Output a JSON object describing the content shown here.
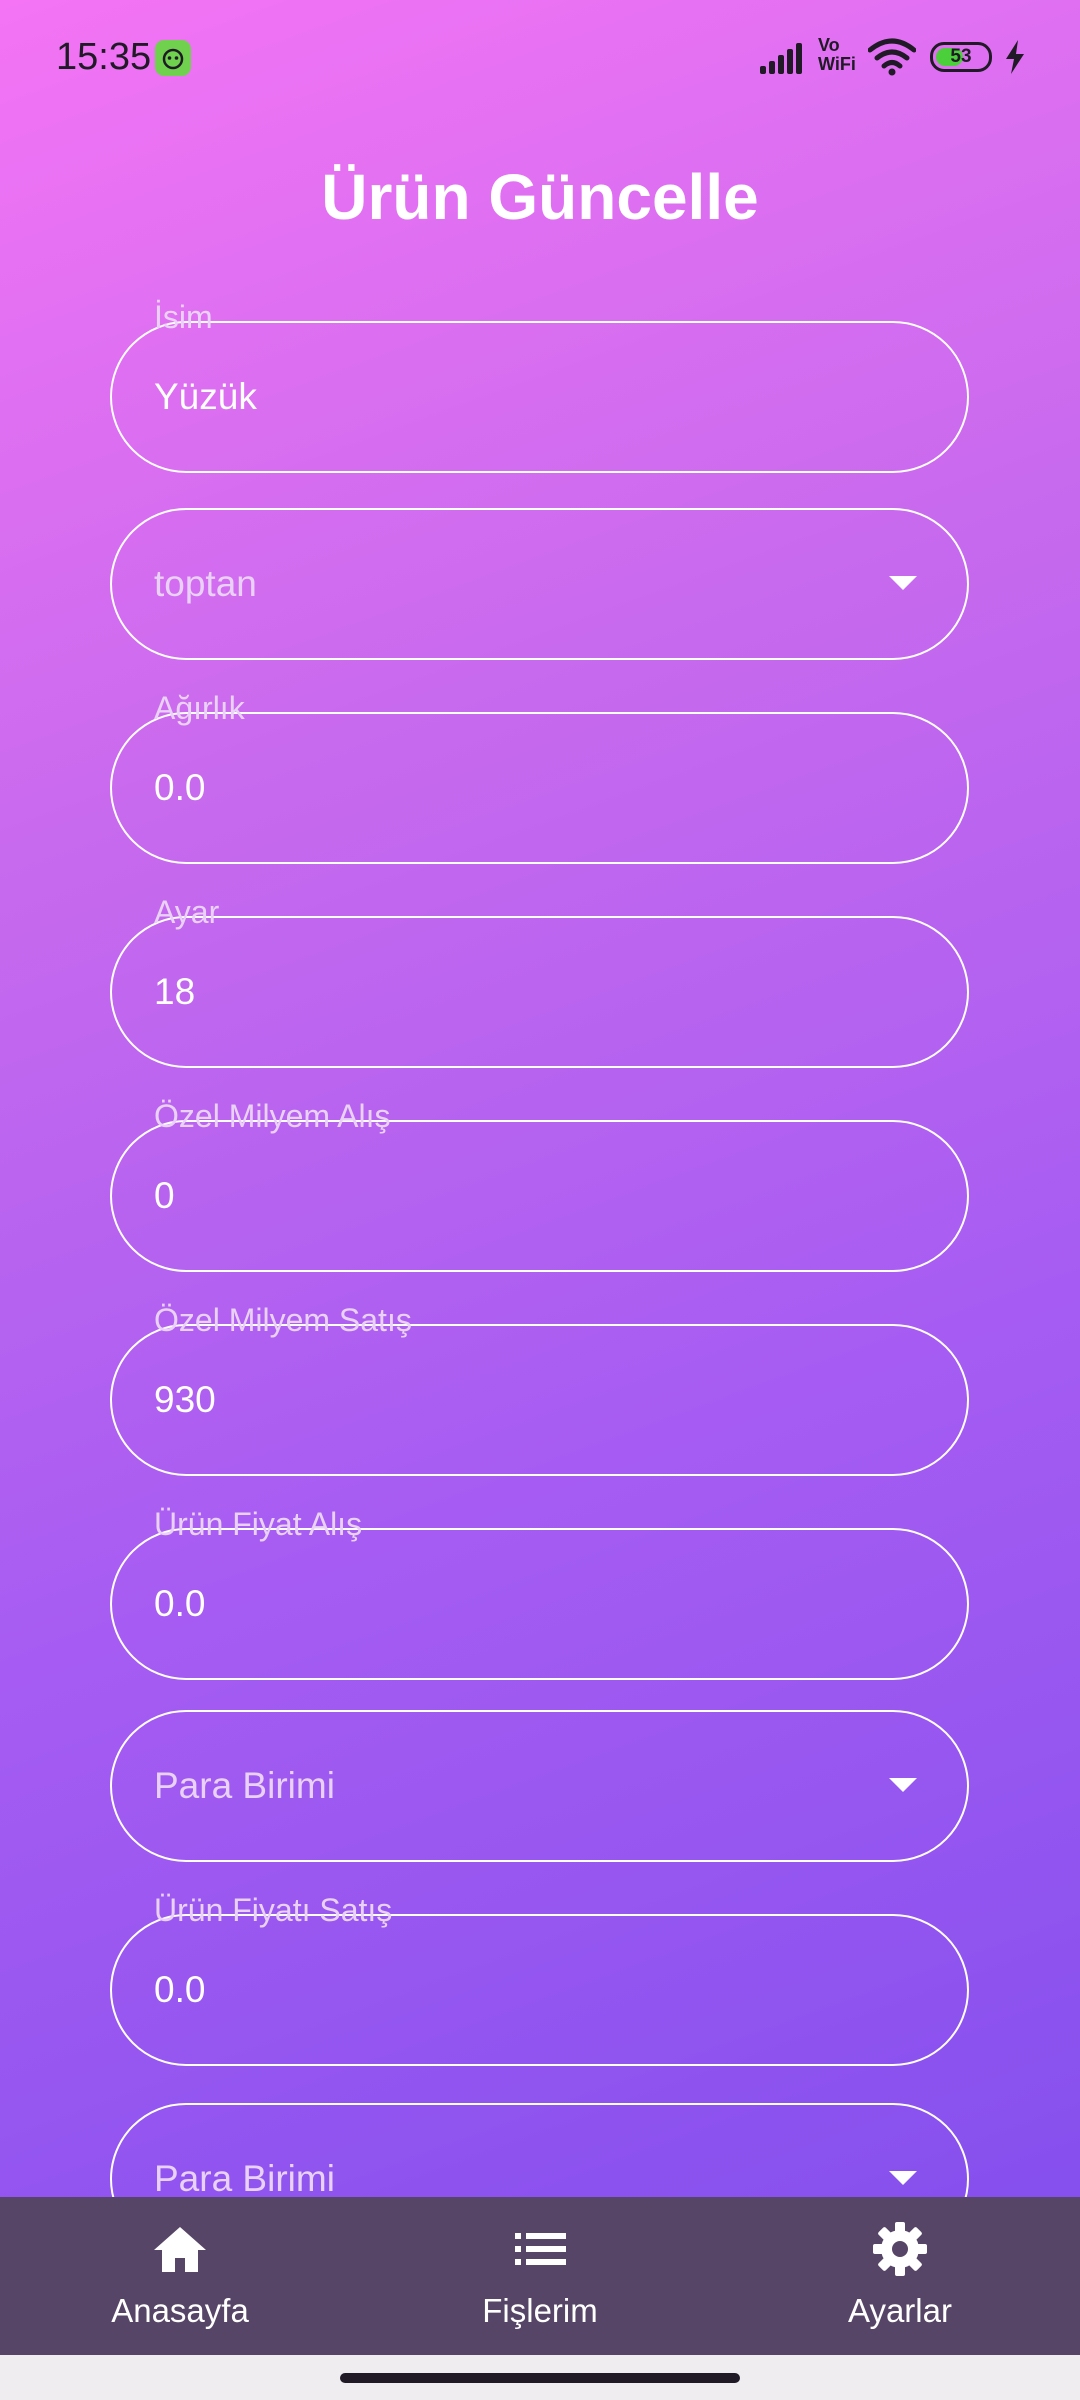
{
  "status_bar": {
    "time": "15:35",
    "network_label": "Vo\nWiFi",
    "battery": "53",
    "battery_level": 0.53
  },
  "page": {
    "title": "Ürün Güncelle"
  },
  "form": {
    "fields": [
      {
        "label": "İsim",
        "value": "Yüzük",
        "type": "text"
      },
      {
        "placeholder": "toptan",
        "type": "dropdown"
      },
      {
        "label": "Ağırlık",
        "value": "0.0",
        "type": "text"
      },
      {
        "label": "Ayar",
        "value": "18",
        "type": "text"
      },
      {
        "label": "Özel Milyem Alış",
        "value": "0",
        "type": "text"
      },
      {
        "label": "Özel Milyem Satış",
        "value": "930",
        "type": "text"
      },
      {
        "label": "Ürün Fiyat Alış",
        "value": "0.0",
        "type": "text"
      },
      {
        "placeholder": "Para Birimi",
        "type": "dropdown"
      },
      {
        "label": "Ürün Fiyatı Satış",
        "value": "0.0",
        "type": "text"
      },
      {
        "placeholder": "Para Birimi",
        "type": "dropdown"
      }
    ]
  },
  "bottom_nav": {
    "items": [
      {
        "label": "Anasayfa",
        "icon": "home-icon"
      },
      {
        "label": "Fişlerim",
        "icon": "list-icon"
      },
      {
        "label": "Ayarlar",
        "icon": "gear-icon"
      }
    ]
  },
  "colors": {
    "gradient_top": "#f474f5",
    "gradient_bottom": "#7e4ded",
    "nav_background": "#564567"
  }
}
